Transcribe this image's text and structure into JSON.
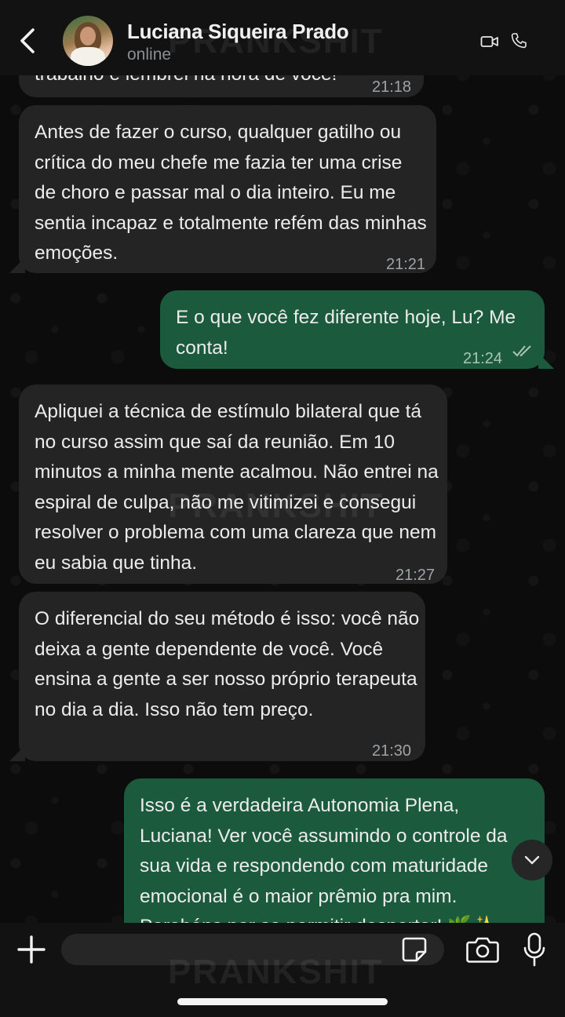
{
  "header": {
    "contact_name": "Luciana Siqueira Prado",
    "status": "online"
  },
  "messages": [
    {
      "direction": "in",
      "text": "trabalho e lembrei na hora de você!",
      "time": "21:18"
    },
    {
      "direction": "in",
      "text": "Antes de fazer o curso, qualquer gatilho ou crítica do meu chefe me fazia ter uma crise de choro e passar mal o dia inteiro. Eu me sentia incapaz e totalmente refém das minhas emoções.",
      "time": "21:21"
    },
    {
      "direction": "out",
      "text": "E o que você fez diferente hoje, Lu? Me conta!",
      "time": "21:24",
      "status": "read"
    },
    {
      "direction": "in",
      "text": "Apliquei a técnica de estímulo bilateral que tá no curso assim que saí da reunião. Em 10 minutos a minha mente acalmou. Não entrei na espiral de culpa, não me vitimizei e consegui resolver o problema com uma clareza que nem eu sabia que tinha.",
      "time": "21:27"
    },
    {
      "direction": "in",
      "text": "O diferencial do seu método é isso: você não deixa a gente dependente de você. Você ensina a gente a ser nosso próprio terapeuta no dia a dia. Isso não tem preço.",
      "time": "21:30"
    },
    {
      "direction": "out",
      "text": "Isso é a verdadeira Autonomia Plena, Luciana! Ver você assumindo o controle da sua vida e respondendo com maturidade emocional é o maior prêmio pra mim. Parabéns por se permitir despertar! 🌿✨",
      "time": ""
    }
  ],
  "composer": {
    "value": "",
    "placeholder": ""
  },
  "watermark": "PRANKSHIT",
  "colors": {
    "incoming_bubble": "#242424",
    "outgoing_bubble": "#1c5a3e",
    "header_bg": "#121212",
    "text": "#ececec",
    "timestamp": "#9da3a6"
  },
  "icons": [
    "back-arrow-icon",
    "video-call-icon",
    "phone-icon",
    "chevron-down-icon",
    "plus-icon",
    "sticker-icon",
    "camera-icon",
    "microphone-icon",
    "double-check-icon"
  ]
}
